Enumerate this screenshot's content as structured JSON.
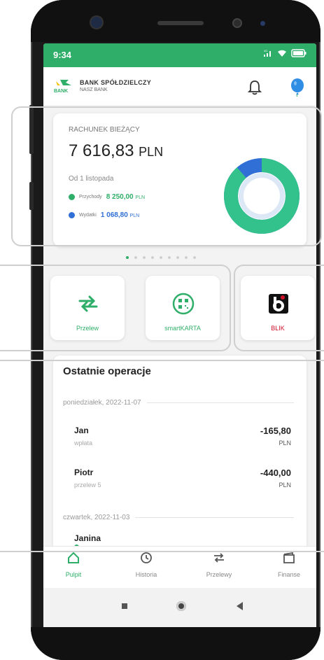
{
  "status_bar": {
    "time": "9:34"
  },
  "header": {
    "bank_name": "BANK SPÓŁDZIELCZY",
    "bank_subname": "NASZ BANK",
    "logo_text": "BANK"
  },
  "account": {
    "type": "RACHUNEK BIEŻĄCY",
    "balance": "7 616,83",
    "currency": "PLN",
    "since": "Od 1 listopada",
    "income_label": "Przychody",
    "income_amount": "8 250,00",
    "income_currency": "PLN",
    "expense_label": "Wydatki",
    "expense_amount": "1 068,80",
    "expense_currency": "PLN",
    "income_fraction": 0.885
  },
  "pager": {
    "count": 9,
    "active": 0
  },
  "tiles": [
    {
      "label": "Przelew"
    },
    {
      "label": "smartKARTA"
    },
    {
      "label": "BLIK"
    }
  ],
  "operations": {
    "title": "Ostatnie operacje",
    "groups": [
      {
        "date": "poniedziałek, 2022-11-07",
        "items": [
          {
            "name": "Jan",
            "desc": "wpłata",
            "amount": "-165,80",
            "currency": "PLN"
          },
          {
            "name": "Piotr",
            "desc": "przelew 5",
            "amount": "-440,00",
            "currency": "PLN"
          }
        ]
      },
      {
        "date": "czwartek, 2022-11-03",
        "items": [
          {
            "name": "Janina"
          }
        ]
      }
    ]
  },
  "bottom_nav": [
    {
      "label": "Pulpit",
      "active": true
    },
    {
      "label": "Historia"
    },
    {
      "label": "Przelewy"
    },
    {
      "label": "Finanse"
    }
  ],
  "colors": {
    "accent": "#2eae68",
    "expense": "#2f6fd6",
    "blik": "#d0102a"
  }
}
